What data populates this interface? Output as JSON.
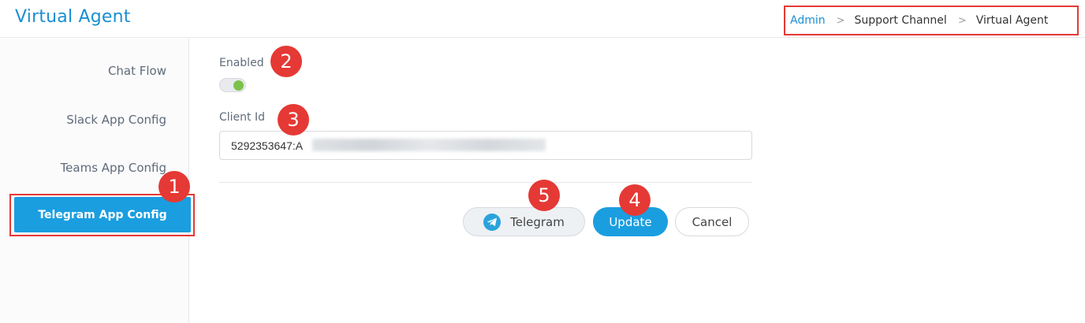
{
  "header": {
    "title": "Virtual Agent",
    "breadcrumb": {
      "link": "Admin",
      "middle": "Support Channel",
      "current": "Virtual Agent",
      "separator": ">"
    }
  },
  "sidebar": {
    "items": [
      {
        "label": "Chat Flow"
      },
      {
        "label": "Slack App Config"
      },
      {
        "label": "Teams App Config"
      },
      {
        "label": "Telegram App Config",
        "active": true
      }
    ]
  },
  "form": {
    "enabled_label": "Enabled",
    "enabled_value": true,
    "client_id_label": "Client Id",
    "client_id_value": "5292353647:A"
  },
  "actions": {
    "telegram_label": "Telegram",
    "update_label": "Update",
    "cancel_label": "Cancel"
  },
  "callouts": [
    "1",
    "2",
    "3",
    "4",
    "5"
  ],
  "colors": {
    "accent": "#1a9ee0",
    "title": "#1a8fd1",
    "highlight": "#e53935",
    "toggle_on": "#7cc24a"
  },
  "icons": {
    "telegram": "telegram-icon",
    "separator": "chevron-right-icon"
  }
}
